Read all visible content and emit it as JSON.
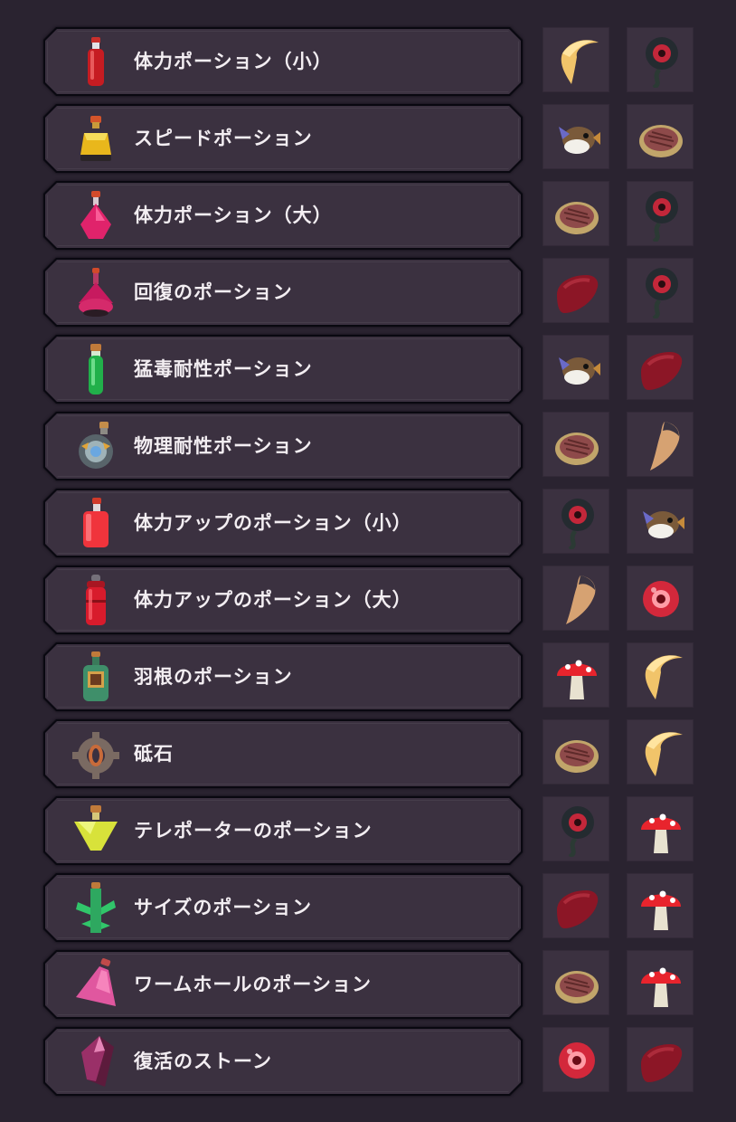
{
  "recipes": [
    {
      "name": "体力ポーション（小）",
      "icon": "red-tall-bottle-icon",
      "ingredients": [
        "fang-icon",
        "eyeball-pod-icon"
      ]
    },
    {
      "name": "スピードポーション",
      "icon": "yellow-flask-icon",
      "ingredients": [
        "pufferfish-icon",
        "meat-slab-icon"
      ]
    },
    {
      "name": "体力ポーション（大）",
      "icon": "pink-flask-icon",
      "ingredients": [
        "meat-slab-icon",
        "eyeball-pod-icon"
      ]
    },
    {
      "name": "回復のポーション",
      "icon": "round-pink-flask-icon",
      "ingredients": [
        "liver-icon",
        "eyeball-pod-icon"
      ]
    },
    {
      "name": "猛毒耐性ポーション",
      "icon": "green-vial-icon",
      "ingredients": [
        "pufferfish-icon",
        "liver-icon"
      ]
    },
    {
      "name": "物理耐性ポーション",
      "icon": "armored-orb-bottle-icon",
      "ingredients": [
        "meat-slab-icon",
        "horn-icon"
      ]
    },
    {
      "name": "体力アップのポーション（小）",
      "icon": "red-square-bottle-icon",
      "ingredients": [
        "eyeball-pod-icon",
        "pufferfish-icon"
      ]
    },
    {
      "name": "体力アップのポーション（大）",
      "icon": "red-canister-icon",
      "ingredients": [
        "horn-icon",
        "red-orb-icon"
      ]
    },
    {
      "name": "羽根のポーション",
      "icon": "green-framed-bottle-icon",
      "ingredients": [
        "mushroom-icon",
        "fang-icon"
      ]
    },
    {
      "name": "砥石",
      "icon": "whetstone-gear-icon",
      "ingredients": [
        "meat-slab-icon",
        "fang-icon"
      ]
    },
    {
      "name": "テレポーターのポーション",
      "icon": "yellow-triangle-flask-icon",
      "ingredients": [
        "eyeball-pod-icon",
        "mushroom-icon"
      ]
    },
    {
      "name": "サイズのポーション",
      "icon": "green-cactus-bottle-icon",
      "ingredients": [
        "liver-icon",
        "mushroom-icon"
      ]
    },
    {
      "name": "ワームホールのポーション",
      "icon": "pink-tilted-flask-icon",
      "ingredients": [
        "meat-slab-icon",
        "mushroom-icon"
      ]
    },
    {
      "name": "復活のストーン",
      "icon": "purple-crystal-icon",
      "ingredients": [
        "red-orb-icon",
        "liver-icon"
      ]
    }
  ],
  "colors": {
    "background": "#2a2330",
    "panel": "#3b3140",
    "panel_border": "#090810",
    "text": "#f3eef2"
  }
}
